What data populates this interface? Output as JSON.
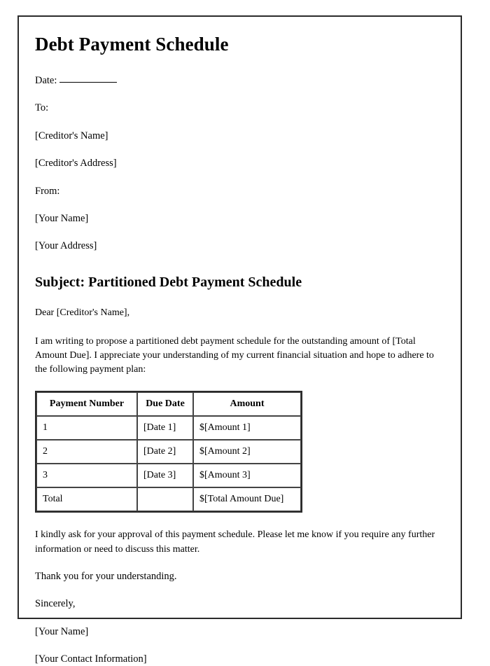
{
  "document": {
    "title": "Debt Payment Schedule",
    "date_label": "Date:",
    "to_label": "To:",
    "creditor_name": "[Creditor's Name]",
    "creditor_address": "[Creditor's Address]",
    "from_label": "From:",
    "your_name": "[Your Name]",
    "your_address": "[Your Address]",
    "subject": "Subject: Partitioned Debt Payment Schedule",
    "salutation": "Dear [Creditor's Name],",
    "intro_paragraph": "I am writing to propose a partitioned debt payment schedule for the outstanding amount of [Total Amount Due]. I appreciate your understanding of my current financial situation and hope to adhere to the following payment plan:",
    "closing_paragraph": "I kindly ask for your approval of this payment schedule. Please let me know if you require any further information or need to discuss this matter.",
    "thanks": "Thank you for your understanding.",
    "sign_off": "Sincerely,",
    "signature_name": "[Your Name]",
    "signature_contact": "[Your Contact Information]"
  },
  "table": {
    "headers": [
      "Payment Number",
      "Due Date",
      "Amount"
    ],
    "rows": [
      [
        "1",
        "[Date 1]",
        "$[Amount 1]"
      ],
      [
        "2",
        "[Date 2]",
        "$[Amount 2]"
      ],
      [
        "3",
        "[Date 3]",
        "$[Amount 3]"
      ],
      [
        "Total",
        "",
        "$[Total Amount Due]"
      ]
    ]
  }
}
